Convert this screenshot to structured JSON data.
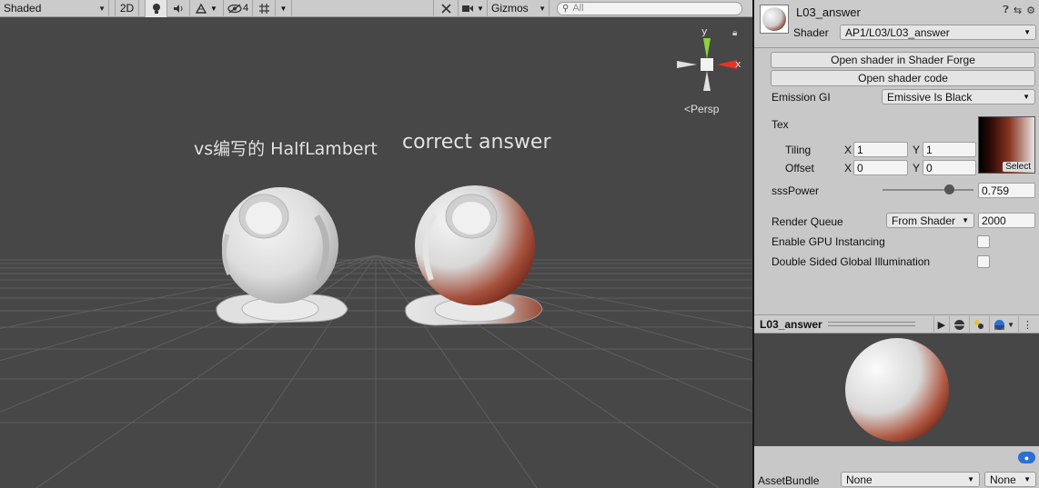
{
  "scene_toolbar": {
    "shading_mode": "Shaded",
    "mode_2d": "2D",
    "lighting_icon": "bulb-icon",
    "audio_icon": "speaker-icon",
    "effects_icon": "effects-icon",
    "hidden_count": "4",
    "grid_icon": "grid-snap-icon",
    "tools_icon": "tools-icon",
    "camera_icon": "camera-icon",
    "gizmos_label": "Gizmos",
    "search_placeholder": "All"
  },
  "scene": {
    "label_left": "vs编写的 HalfLambert",
    "label_right": "correct answer",
    "projection": "Persp",
    "axis_x": "x",
    "axis_y": "y"
  },
  "inspector": {
    "material_name": "L03_answer",
    "shader_label": "Shader",
    "shader_value": "AP1/L03/L03_answer",
    "open_shader_forge": "Open shader in Shader Forge",
    "open_shader_code": "Open shader code",
    "emission_label": "Emission GI",
    "emission_value": "Emissive Is Black",
    "tex_label": "Tex",
    "tiling_label": "Tiling",
    "offset_label": "Offset",
    "x_label": "X",
    "y_label": "Y",
    "tiling_x": "1",
    "tiling_y": "1",
    "offset_x": "0",
    "offset_y": "0",
    "tex_select": "Select",
    "sss_label": "sssPower",
    "sss_value": "0.759",
    "sss_slider_fraction": 0.759,
    "render_queue_label": "Render Queue",
    "render_queue_mode": "From Shader",
    "render_queue_value": "2000",
    "gpu_instancing_label": "Enable GPU Instancing",
    "double_sided_label": "Double Sided Global Illumination"
  },
  "preview": {
    "title": "L03_answer",
    "assetbundle_label": "AssetBundle",
    "assetbundle_value": "None",
    "variant_value": "None"
  },
  "colors": {
    "scene_bg": "#474747",
    "panel_bg": "#c8c8c8",
    "gizmo_x": "#e8322a",
    "gizmo_y": "#8cd23c",
    "shadow_red": "#7a1e0e"
  }
}
